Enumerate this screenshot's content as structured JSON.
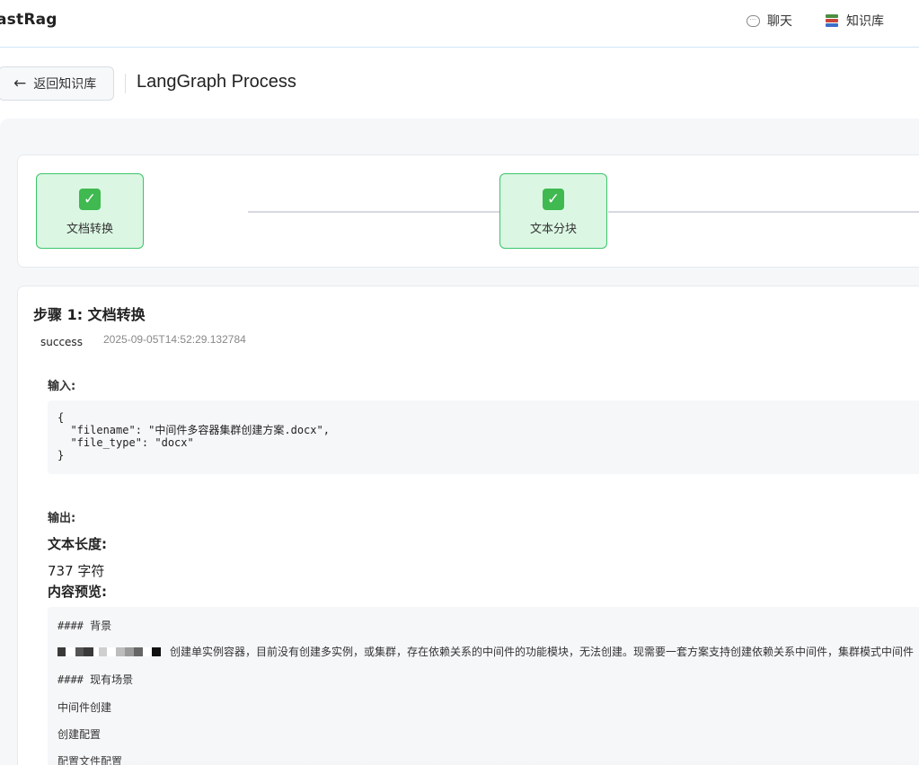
{
  "header": {
    "brand": "astRag",
    "nav": [
      {
        "label": "聊天",
        "icon": "chat-bubble-icon"
      },
      {
        "label": "知识库",
        "icon": "books-icon"
      }
    ]
  },
  "toolbar": {
    "back_label": "返回知识库",
    "back_icon": "arrow-left-icon",
    "page_title": "LangGraph Process"
  },
  "steps": [
    {
      "label": "文档转换",
      "state": "done",
      "icon": "check-icon"
    },
    {
      "label": "文本分块",
      "state": "done",
      "icon": "check-icon"
    }
  ],
  "colors": {
    "step_bg": "#dbf7e3",
    "step_border": "#3cc46a",
    "check": "#3fb950",
    "topbar_border": "#cfe6f5"
  },
  "detail": {
    "heading": "步骤 1: 文档转换",
    "status": "success",
    "timestamp": "2025-09-05T14:52:29.132784",
    "input_label": "输入:",
    "input_json": "{\n  \"filename\": \"中间件多容器集群创建方案.docx\",\n  \"file_type\": \"docx\"\n}",
    "output_label": "输出:",
    "text_length_label": "文本长度:",
    "text_length_value": "737 字符",
    "preview_label": "内容预览:",
    "preview_lines": [
      "#### 背景",
      "创建单实例容器，目前没有创建多实例，或集群，存在依赖关系的中间件的功能模块，无法创建。现需要一套方案支持创建依赖关系中间件，集群模式中间件",
      "#### 现有场景",
      "中间件创建",
      "创建配置",
      "配置文件配置"
    ]
  }
}
